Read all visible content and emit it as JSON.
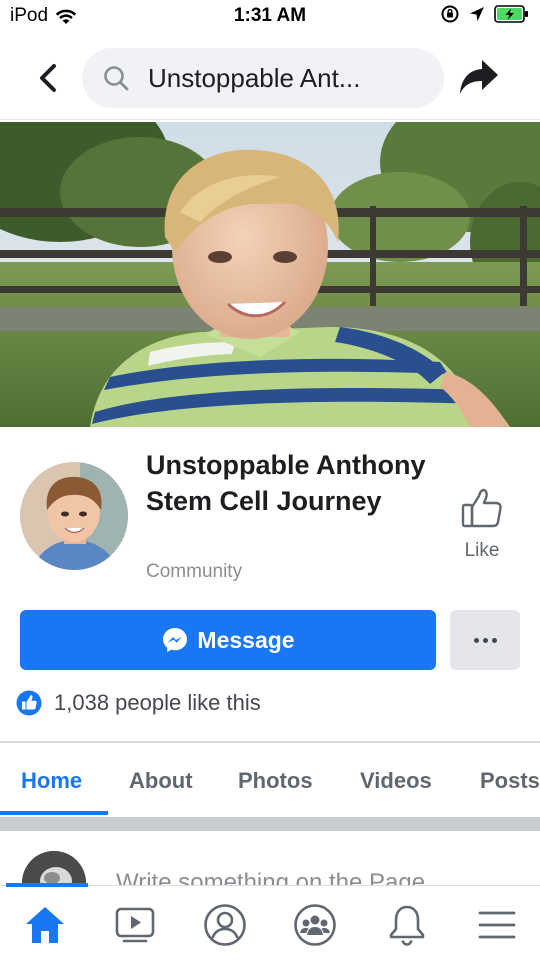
{
  "status_bar": {
    "carrier": "iPod",
    "time": "1:31 AM"
  },
  "nav": {
    "search_text": "Unstoppable Ant..."
  },
  "page": {
    "name": "Unstoppable Anthony Stem Cell Journey",
    "category": "Community",
    "like_label": "Like",
    "message_label": "Message",
    "likes_count_text": "1,038 people like this"
  },
  "tabs": [
    {
      "label": "Home",
      "active": true
    },
    {
      "label": "About",
      "active": false
    },
    {
      "label": "Photos",
      "active": false
    },
    {
      "label": "Videos",
      "active": false
    },
    {
      "label": "Posts",
      "active": false
    }
  ],
  "composer": {
    "placeholder": "Write something on the Page..."
  },
  "bottom_bar": [
    "home-icon",
    "watch-icon",
    "profile-icon",
    "groups-icon",
    "notifications-icon",
    "menu-icon"
  ],
  "colors": {
    "accent": "#1877f2",
    "battery": "#4cd964"
  }
}
